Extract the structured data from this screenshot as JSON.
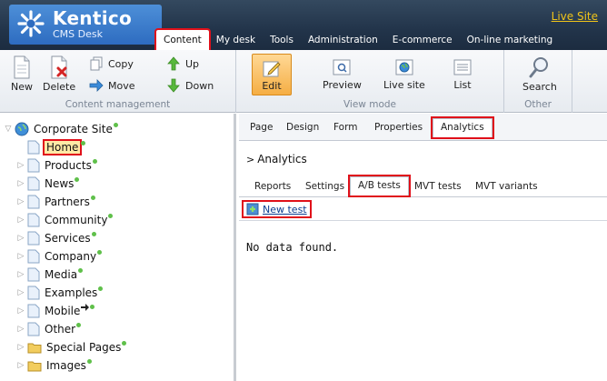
{
  "header": {
    "app_name": "Kentico",
    "app_sub": "CMS Desk",
    "live_site": "Live Site",
    "nav": [
      "Content",
      "My desk",
      "Tools",
      "Administration",
      "E-commerce",
      "On-line marketing"
    ]
  },
  "toolbar": {
    "content_management": {
      "label": "Content management",
      "new": "New",
      "delete": "Delete",
      "copy": "Copy",
      "move": "Move",
      "up": "Up",
      "down": "Down"
    },
    "view_mode": {
      "label": "View mode",
      "edit": "Edit",
      "preview": "Preview",
      "live_site": "Live site",
      "list": "List"
    },
    "other": {
      "label": "Other",
      "search": "Search"
    }
  },
  "tree": {
    "root": "Corporate Site",
    "items": [
      "Home",
      "Products",
      "News",
      "Partners",
      "Community",
      "Services",
      "Company",
      "Media",
      "Examples",
      "Mobile",
      "Other",
      "Special Pages",
      "Images"
    ]
  },
  "content": {
    "tabs": [
      "Page",
      "Design",
      "Form",
      "Properties",
      "Analytics"
    ],
    "section_title": "Analytics",
    "subtabs": [
      "Reports",
      "Settings",
      "A/B tests",
      "MVT tests",
      "MVT variants"
    ],
    "new_test": "New test",
    "no_data": "No data found."
  },
  "colors": {
    "header_bg": "#22344a",
    "logo_bg": "#2e6cc0",
    "live_link": "#f0c419",
    "highlight": "#e0101a",
    "status_dot": "#5fc04a"
  }
}
